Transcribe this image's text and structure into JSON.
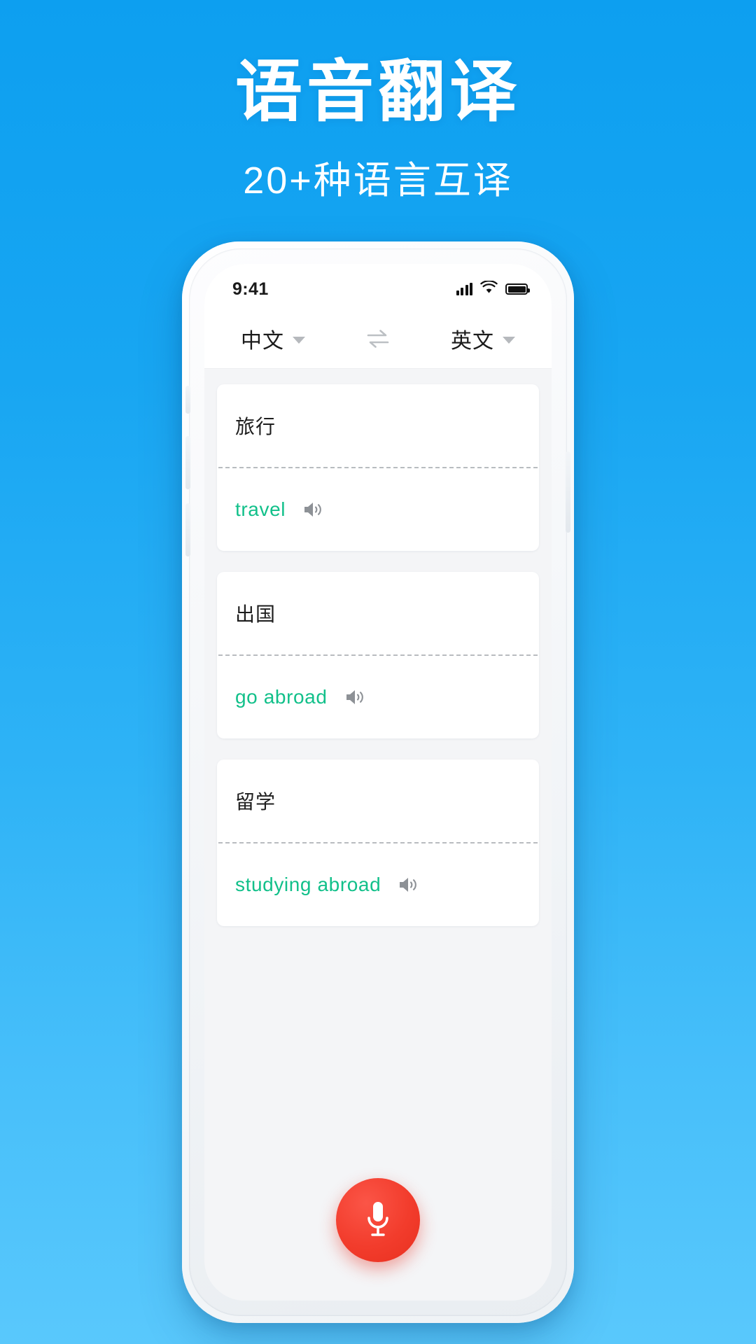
{
  "page": {
    "background_gradient_from": "#0d9ff0",
    "background_gradient_to": "#59c8fc",
    "headline": "语音翻译",
    "subheadline": "20+种语言互译"
  },
  "phone": {
    "status_bar": {
      "time": "9:41",
      "signal_icon": "cellular-signal-icon",
      "wifi_icon": "wifi-icon",
      "battery_icon": "battery-full-icon"
    },
    "language_bar": {
      "source_language": "中文",
      "target_language": "英文",
      "source_caret_icon": "chevron-down-icon",
      "target_caret_icon": "chevron-down-icon",
      "swap_icon": "swap-arrows-icon"
    },
    "cards": [
      {
        "source_text": "旅行",
        "translated_text": "travel",
        "speaker_icon": "speaker-volume-icon"
      },
      {
        "source_text": "出国",
        "translated_text": "go abroad",
        "speaker_icon": "speaker-volume-icon"
      },
      {
        "source_text": "留学",
        "translated_text": "studying abroad",
        "speaker_icon": "speaker-volume-icon"
      }
    ],
    "mic_button": {
      "icon": "microphone-icon",
      "color": "#f23c2c"
    }
  },
  "colors": {
    "accent_blue": "#18a6f2",
    "translation_green": "#12c08a",
    "record_red": "#f23c2c",
    "screen_bg": "#f4f5f7"
  }
}
